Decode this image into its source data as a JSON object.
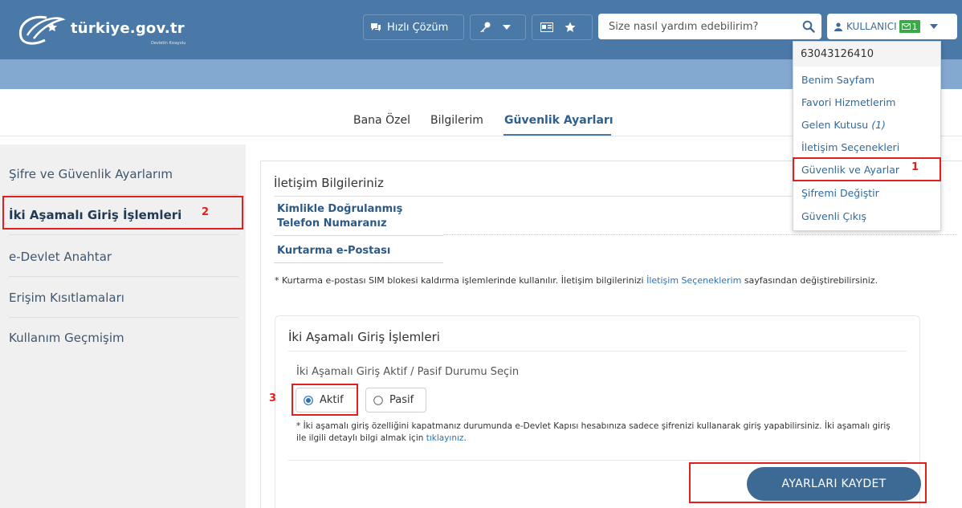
{
  "header": {
    "logo_text": "türkiye.gov.tr",
    "logo_sub": "Devletin Kısayolu",
    "quick_solution_label": "Hızlı Çözüm",
    "search_placeholder": "Size nasıl yardım edebilirim?",
    "user_label": "KULLANICI",
    "message_count": "1"
  },
  "tabs": [
    "Bana Özel",
    "Bilgilerim",
    "Güvenlik Ayarları"
  ],
  "active_tab": "Güvenlik Ayarları",
  "sidebar": {
    "items": [
      "Şifre ve Güvenlik Ayarlarım",
      "İki Aşamalı Giriş İşlemleri",
      "e-Devlet Anahtar",
      "Erişim Kısıtlamaları",
      "Kullanım Geçmişim"
    ]
  },
  "contact": {
    "title": "İletişim Bilgileriniz",
    "verified_phone_label": "Kimlikle Doğrulanmış Telefon Numaranız",
    "recovery_email_label": "Kurtarma e-Postası",
    "note_prefix": "* Kurtarma e-postası SIM blokesi kaldırma işlemlerinde kullanılır. İletişim bilgilerinizi",
    "note_link": "İletişim Seçeneklerim",
    "note_suffix": "sayfasından değiştirebilirsiniz."
  },
  "two_factor": {
    "title": "İki Aşamalı Giriş İşlemleri",
    "subtitle": "İki Aşamalı Giriş Aktif / Pasif Durumu Seçin",
    "option_active": "Aktif",
    "option_passive": "Pasif",
    "selected": "Aktif",
    "note_prefix": "* İki aşamalı giriş özelliğini kapatmanız durumunda e-Devlet Kapısı hesabınıza sadece şifrenizi kullanarak giriş yapabilirsiniz. İki aşamalı giriş ile ilgili detaylı bilgi almak için",
    "note_link": "tıklayınız",
    "note_end": ".",
    "save_label": "AYARLARI KAYDET"
  },
  "dropdown": {
    "user_id": "63043126410",
    "items": [
      "Benim Sayfam",
      "Favori Hizmetlerim",
      "Gelen Kutusu",
      "İletişim Seçenekleri",
      "Güvenlik ve Ayarlar",
      "Şifremi Değiştir",
      "Güvenli Çıkış"
    ],
    "inbox_count": "(1)"
  },
  "annotations": [
    "1",
    "2",
    "3"
  ],
  "colors": {
    "header": "#4a79a8",
    "subbar": "#83a9d0",
    "accent": "#2c5a88",
    "save_button": "#3d6a94",
    "annotation": "#e02020",
    "badge": "#3aaa49"
  },
  "icons": [
    "logo-swoosh-icon",
    "chat-icon",
    "key-icon",
    "id-card-icon",
    "star-icon",
    "search-icon",
    "user-icon",
    "envelope-icon",
    "caret-down-icon",
    "radio-checked-icon",
    "radio-unchecked-icon"
  ]
}
